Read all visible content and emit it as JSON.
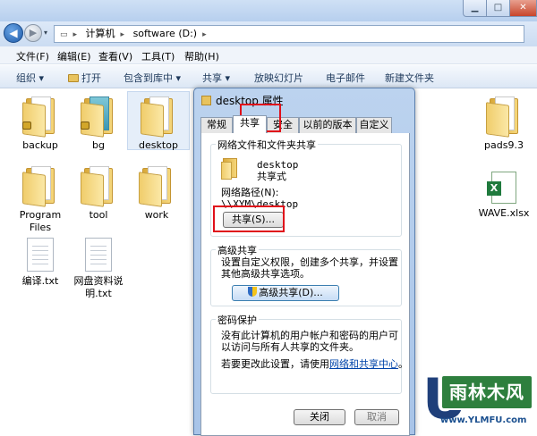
{
  "window": {
    "address": {
      "crumbs": [
        "计算机",
        "software (D:)"
      ]
    }
  },
  "menubar": [
    {
      "label": "文件(F)"
    },
    {
      "label": "编辑(E)"
    },
    {
      "label": "查看(V)"
    },
    {
      "label": "工具(T)"
    },
    {
      "label": "帮助(H)"
    }
  ],
  "toolbar": {
    "organize": "组织 ▾",
    "open": "打开",
    "include": "包含到库中 ▾",
    "share": "共享 ▾",
    "slideshow": "放映幻灯片",
    "email": "电子邮件",
    "new_folder": "新建文件夹"
  },
  "files": [
    {
      "label": "backup"
    },
    {
      "label": "bg"
    },
    {
      "label": "desktop"
    },
    {
      "label": "pads9.3"
    },
    {
      "label": "Program Files"
    },
    {
      "label": "tool"
    },
    {
      "label": "work"
    },
    {
      "label": "WAVE.xlsx"
    },
    {
      "label": "编译.txt"
    },
    {
      "label": "网盘资料说明.txt"
    }
  ],
  "dialog": {
    "title": "desktop 属性",
    "tabs": [
      "常规",
      "共享",
      "安全",
      "以前的版本",
      "自定义"
    ],
    "active_tab": "共享",
    "network_sharing": {
      "group_title": "网络文件和文件夹共享",
      "folder_name": "desktop",
      "share_status": "共享式",
      "path_label": "网络路径(N):",
      "path_value": "\\\\XYM\\desktop",
      "share_button": "共享(S)..."
    },
    "advanced_sharing": {
      "group_title": "高级共享",
      "description": "设置自定义权限，创建多个共享，并设置其他高级共享选项。",
      "button": "高级共享(D)..."
    },
    "password_protection": {
      "group_title": "密码保护",
      "description": "没有此计算机的用户帐户和密码的用户可以访问与所有人共享的文件夹。",
      "change_prefix": "若要更改此设置，请使用",
      "change_link": "网络和共享中心",
      "change_suffix": "。"
    },
    "buttons": {
      "close": "关闭",
      "cancel": "取消"
    }
  },
  "watermark": {
    "box_text": "雨林木风",
    "url": "www.YLMFU.com"
  }
}
